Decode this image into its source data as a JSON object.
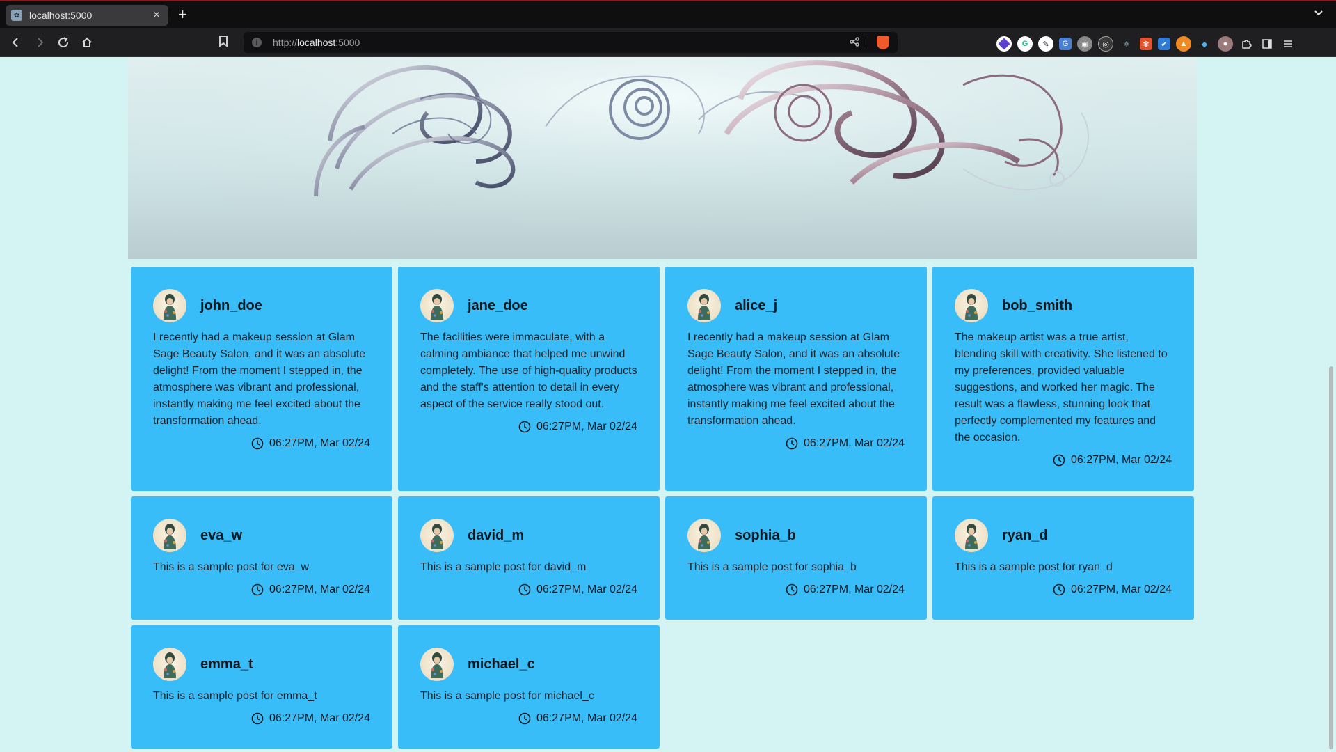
{
  "browser": {
    "tab_title": "localhost:5000",
    "tab_close": "×",
    "new_tab": "+",
    "url_scheme": "http://",
    "url_host": "localhost",
    "url_port": ":5000",
    "extensions": [
      "proton-vpn-icon",
      "grammarly-icon",
      "extension-icon",
      "translate-icon",
      "extension-icon",
      "extension-icon",
      "react-devtools-icon",
      "extension-icon",
      "extension-icon",
      "extension-icon",
      "extension-icon",
      "extension-icon"
    ]
  },
  "colors": {
    "page_bg": "#d4f4f4",
    "card_bg": "#38bdf8",
    "text": "#101820"
  },
  "posts": [
    {
      "username": "john_doe",
      "body": "I recently had a makeup session at Glam Sage Beauty Salon, and it was an absolute delight! From the moment I stepped in, the atmosphere was vibrant and professional, instantly making me feel excited about the transformation ahead.",
      "time": "06:27PM, Mar 02/24"
    },
    {
      "username": "jane_doe",
      "body": "The facilities were immaculate, with a calming ambiance that helped me unwind completely. The use of high-quality products and the staff's attention to detail in every aspect of the service really stood out.",
      "time": "06:27PM, Mar 02/24"
    },
    {
      "username": "alice_j",
      "body": "I recently had a makeup session at Glam Sage Beauty Salon, and it was an absolute delight! From the moment I stepped in, the atmosphere was vibrant and professional, instantly making me feel excited about the transformation ahead.",
      "time": "06:27PM, Mar 02/24"
    },
    {
      "username": "bob_smith",
      "body": "The makeup artist was a true artist, blending skill with creativity. She listened to my preferences, provided valuable suggestions, and worked her magic. The result was a flawless, stunning look that perfectly complemented my features and the occasion.",
      "time": "06:27PM, Mar 02/24"
    },
    {
      "username": "eva_w",
      "body": "This is a sample post for eva_w",
      "time": "06:27PM, Mar 02/24"
    },
    {
      "username": "david_m",
      "body": "This is a sample post for david_m",
      "time": "06:27PM, Mar 02/24"
    },
    {
      "username": "sophia_b",
      "body": "This is a sample post for sophia_b",
      "time": "06:27PM, Mar 02/24"
    },
    {
      "username": "ryan_d",
      "body": "This is a sample post for ryan_d",
      "time": "06:27PM, Mar 02/24"
    },
    {
      "username": "emma_t",
      "body": "This is a sample post for emma_t",
      "time": "06:27PM, Mar 02/24"
    },
    {
      "username": "michael_c",
      "body": "This is a sample post for michael_c",
      "time": "06:27PM, Mar 02/24"
    }
  ]
}
